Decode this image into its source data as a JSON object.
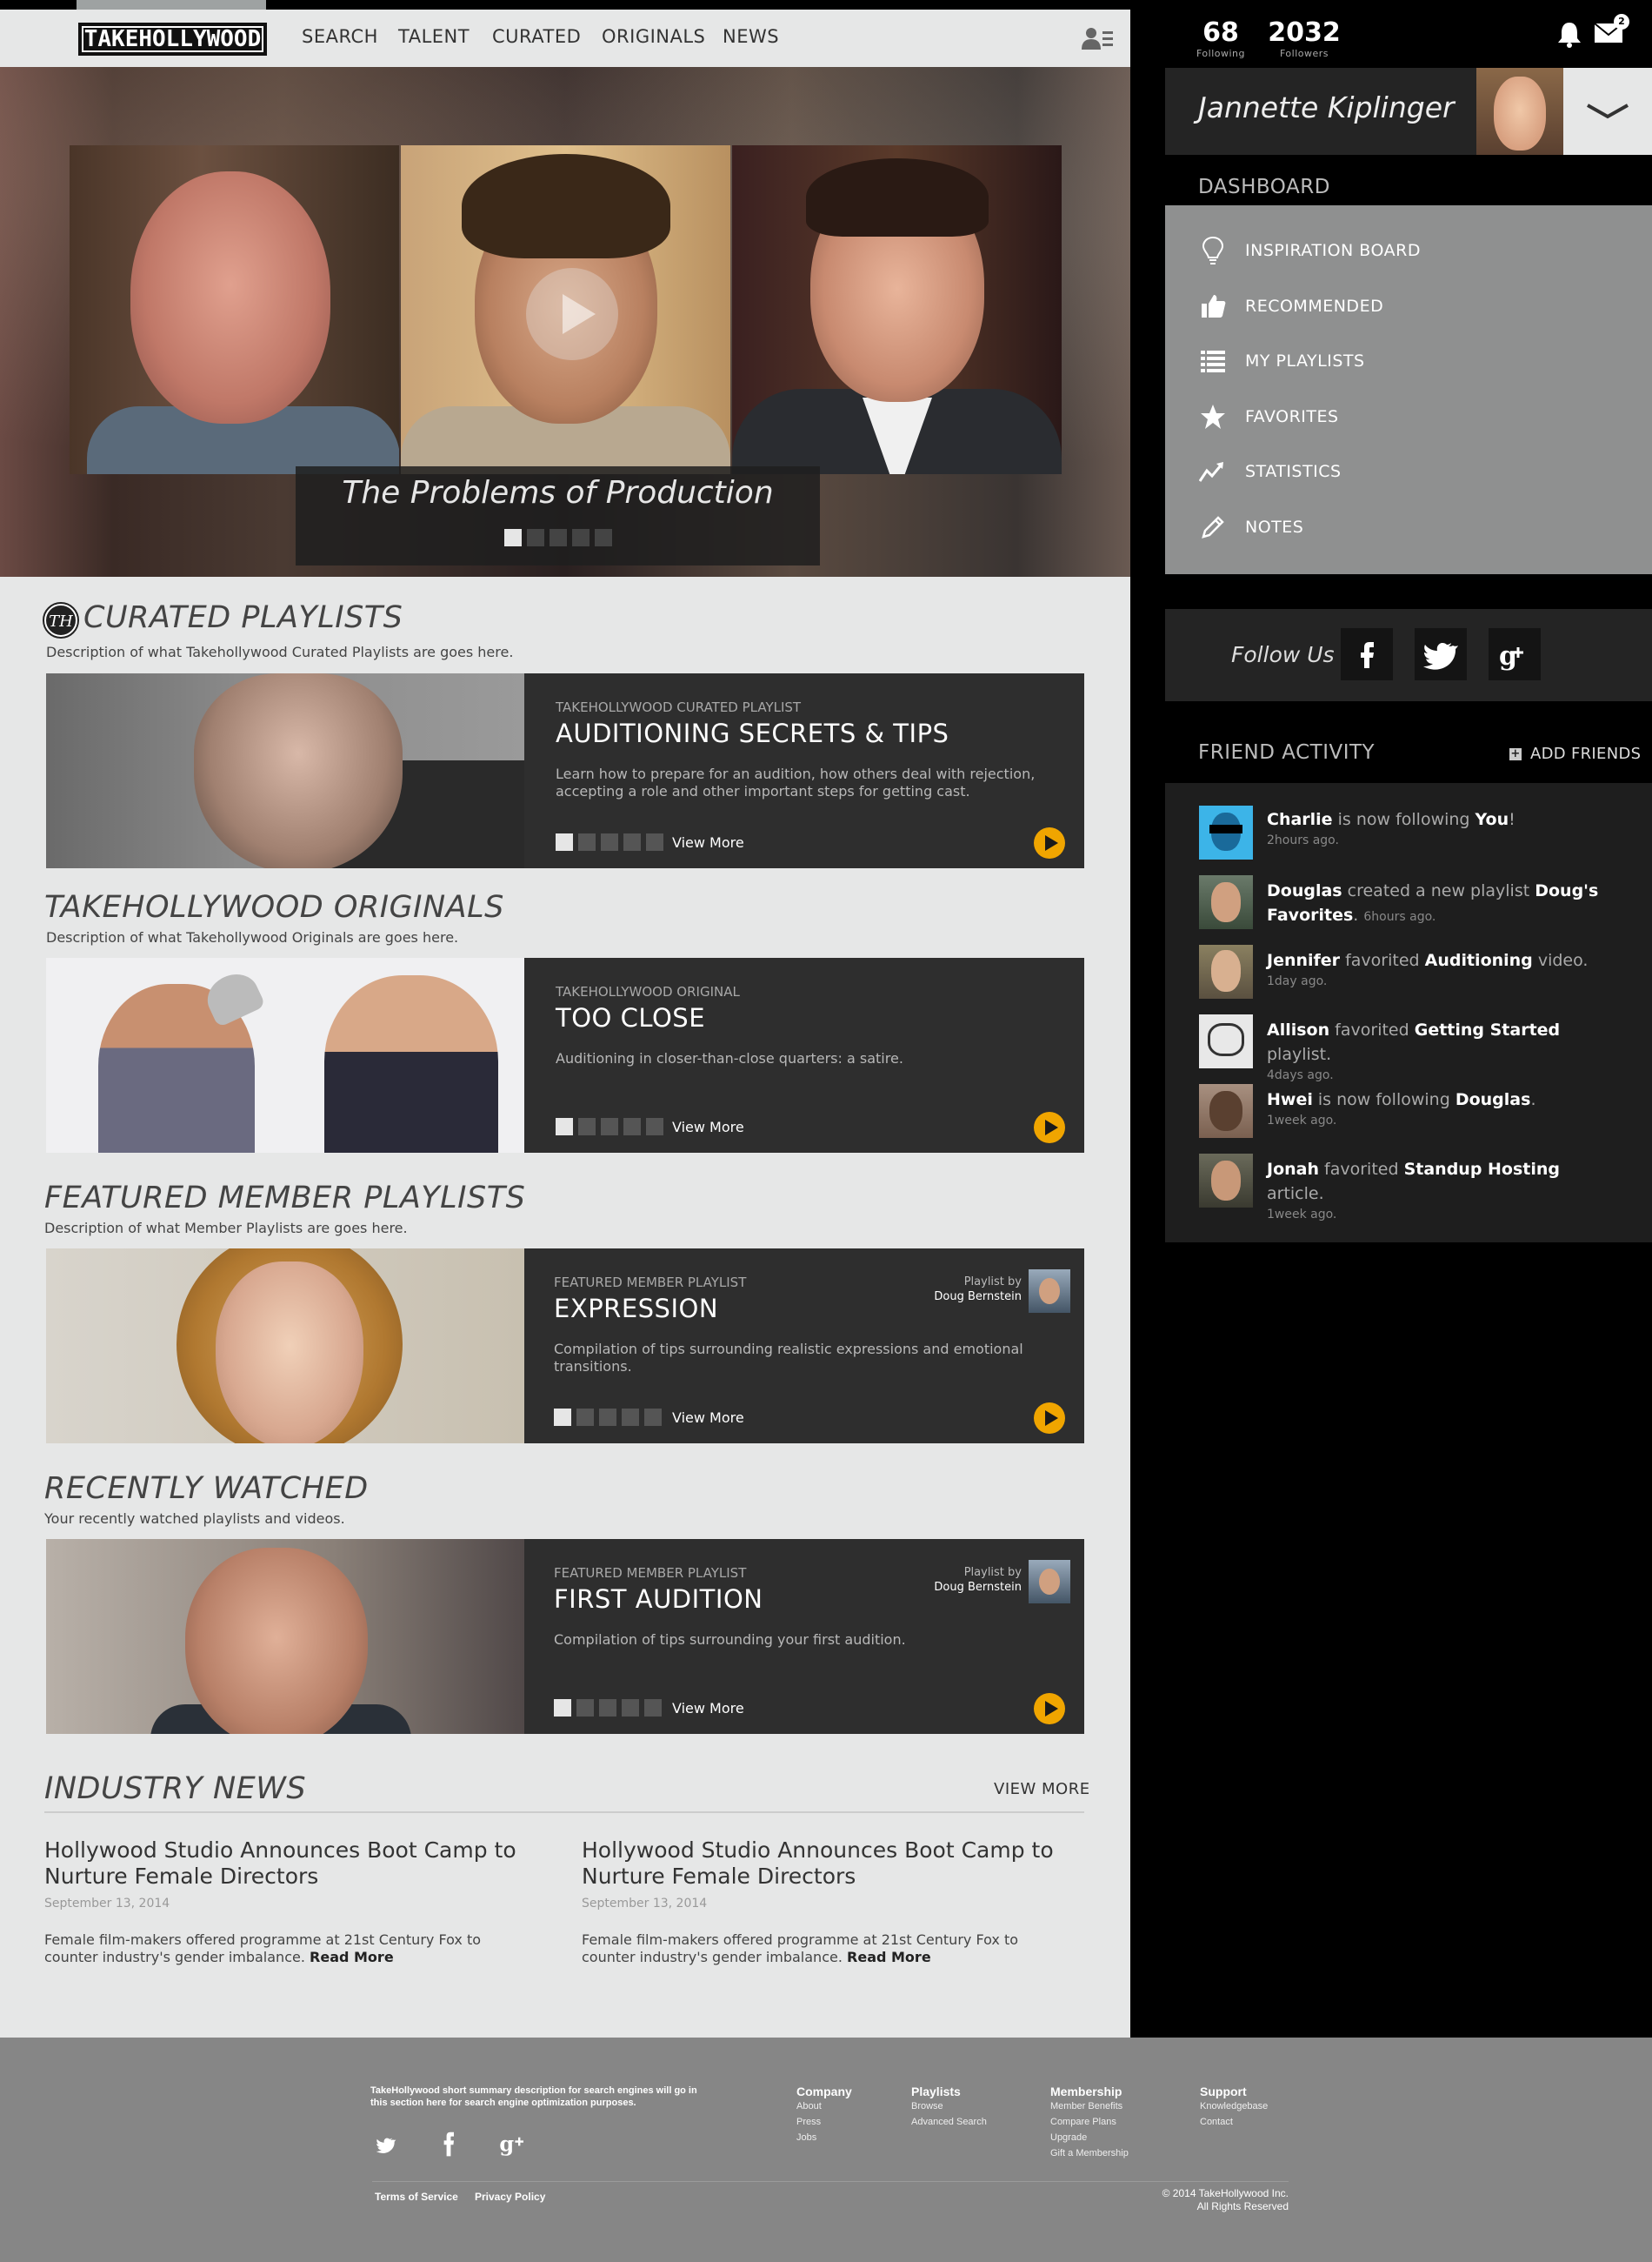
{
  "header": {
    "logo": "TAKEHOLLYWOOD",
    "nav": [
      "SEARCH",
      "TALENT",
      "CURATED",
      "ORIGINALS",
      "NEWS"
    ]
  },
  "hero": {
    "title": "The Problems of Production",
    "slides": 5,
    "active_slide": 1
  },
  "sections": {
    "curated": {
      "title": "CURATED PLAYLISTS",
      "icon_text": "TH",
      "desc": "Description of what Takehollywood Curated Playlists are goes here.",
      "card": {
        "label": "TAKEHOLLYWOOD CURATED PLAYLIST",
        "title": "AUDITIONING SECRETS & TIPS",
        "desc": "Learn how to prepare for an audition, how others deal with rejection, accepting a role and other important steps for getting cast.",
        "view_more": "View More"
      }
    },
    "originals": {
      "title": "TAKEHOLLYWOOD ORIGINALS",
      "desc": "Description of what Takehollywood Originals are goes here.",
      "card": {
        "label": "TAKEHOLLYWOOD ORIGINAL",
        "title": "TOO CLOSE",
        "desc": "Auditioning in closer-than-close quarters: a satire.",
        "view_more": "View More"
      }
    },
    "featured": {
      "title": "FEATURED MEMBER PLAYLISTS",
      "desc": "Description of what Member Playlists are goes here.",
      "card": {
        "label": "FEATURED MEMBER PLAYLIST",
        "title": "EXPRESSION",
        "desc": "Compilation of tips surrounding realistic expressions and emotional transitions.",
        "view_more": "View More",
        "by_label": "Playlist by",
        "by_name": "Doug Bernstein"
      }
    },
    "recent": {
      "title": "RECENTLY WATCHED",
      "desc": "Your recently watched playlists and videos.",
      "card": {
        "label": "FEATURED MEMBER PLAYLIST",
        "title": "FIRST AUDITION",
        "desc": "Compilation of tips surrounding your first audition.",
        "view_more": "View More",
        "by_label": "Playlist by",
        "by_name": "Doug Bernstein"
      }
    },
    "news": {
      "title": "INDUSTRY NEWS",
      "view_more": "VIEW MORE",
      "items": [
        {
          "title": "Hollywood Studio Announces Boot Camp to Nurture Female Directors",
          "date": "September 13, 2014",
          "body": "Female film-makers offered programme at 21st Century Fox to counter industry's gender imbalance.",
          "read_more": "Read More"
        },
        {
          "title": "Hollywood Studio Announces Boot Camp to Nurture Female Directors",
          "date": "September 13, 2014",
          "body": "Female film-makers offered programme at 21st Century Fox to counter industry's gender imbalance.",
          "read_more": "Read More"
        }
      ]
    }
  },
  "sidebar": {
    "following": "68",
    "following_label": "Following",
    "followers": "2032",
    "followers_label": "Followers",
    "mail_badge": "2",
    "profile_name": "Jannette Kiplinger",
    "dashboard_label": "DASHBOARD",
    "dashboard": [
      {
        "icon": "lightbulb-icon",
        "label": "INSPIRATION BOARD"
      },
      {
        "icon": "thumbs-up-icon",
        "label": "RECOMMENDED"
      },
      {
        "icon": "list-icon",
        "label": "MY PLAYLISTS"
      },
      {
        "icon": "star-icon",
        "label": "FAVORITES"
      },
      {
        "icon": "trend-chart-icon",
        "label": "STATISTICS"
      },
      {
        "icon": "pencil-icon",
        "label": "NOTES"
      }
    ],
    "follow_us": "Follow Us",
    "social": [
      "f",
      "twitter",
      "g+"
    ],
    "friend_activity_label": "FRIEND ACTIVITY",
    "add_friends": "ADD FRIENDS",
    "activity": [
      {
        "name": "Charlie",
        "pre": " is now following ",
        "obj": "You",
        "post": "!",
        "time": "2hours ago."
      },
      {
        "name": "Douglas",
        "pre": " created a new playlist ",
        "obj": "Doug's Favorites",
        "post": ".",
        "time": "6hours ago."
      },
      {
        "name": "Jennifer",
        "pre": " favorited ",
        "obj": "Auditioning",
        "post": " video.",
        "time": "1day ago."
      },
      {
        "name": "Allison",
        "pre": " favorited ",
        "obj": "Getting Started",
        "post": " playlist.",
        "time": "4days ago."
      },
      {
        "name": "Hwei",
        "pre": " is now following ",
        "obj": "Douglas",
        "post": ".",
        "time": "1week ago."
      },
      {
        "name": "Jonah",
        "pre": " favorited ",
        "obj": "Standup Hosting",
        "post": " article.",
        "time": "1week ago."
      }
    ]
  },
  "footer": {
    "summary": "TakeHollywood short summary description for  search engines will go in this section here for search engine optimization purposes.",
    "columns": [
      {
        "head": "Company",
        "links": [
          "About",
          "Press",
          "Jobs"
        ]
      },
      {
        "head": "Playlists",
        "links": [
          "Browse",
          "Advanced Search"
        ]
      },
      {
        "head": "Membership",
        "links": [
          "Member Benefits",
          "Compare Plans",
          "Upgrade",
          "Gift a Membership"
        ]
      },
      {
        "head": "Support",
        "links": [
          "Knowledgebase",
          "Contact"
        ]
      }
    ],
    "terms": "Terms of Service",
    "privacy": "Privacy Policy",
    "copyright": "© 2014 TakeHollywood Inc.",
    "rights": "All Rights Reserved"
  },
  "colors": {
    "accent_play": "#f0a500",
    "panel_dark": "#2e2e2e",
    "dashboard_panel": "#8f9090"
  }
}
